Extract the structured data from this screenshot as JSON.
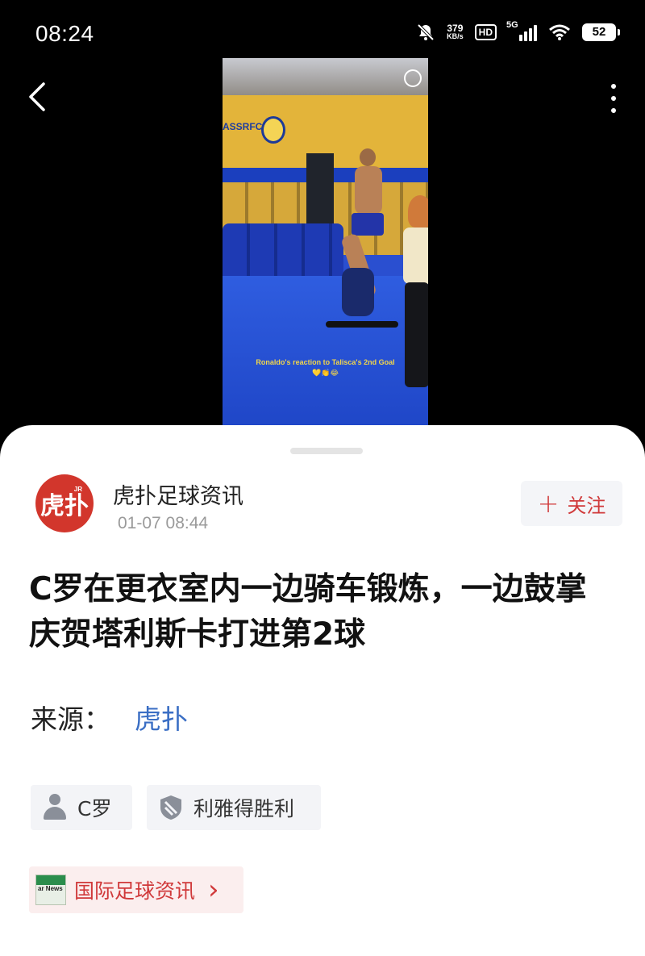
{
  "status_bar": {
    "time": "08:24",
    "net_speed_value": "379",
    "net_speed_unit": "KB/s",
    "hd_label": "HD",
    "network_label": "5G",
    "battery_level": "52",
    "icons": [
      "mute-bell-icon",
      "hd-icon",
      "signal-5g-icon",
      "wifi-icon",
      "battery-icon"
    ]
  },
  "video": {
    "wall_text": "ASSRFC",
    "caption": "Ronaldo's reaction to Talisca's 2nd Goal",
    "caption_emojis": "💛👏😂"
  },
  "nav": {
    "back_icon": "chevron-left-icon",
    "more_icon": "more-vertical-icon"
  },
  "author": {
    "avatar_text": "虎扑",
    "avatar_badge": "JR",
    "name": "虎扑足球资讯",
    "time": "01-07 08:44",
    "follow_label": "关注",
    "follow_icon": "+"
  },
  "article": {
    "title": "C罗在更衣室内一边骑车锻炼，一边鼓掌庆贺塔利斯卡打进第2球",
    "source_label": "来源：",
    "source_name": "虎扑"
  },
  "tags": [
    {
      "label": "C罗",
      "icon": "person-icon"
    },
    {
      "label": "利雅得胜利",
      "icon": "shield-icon"
    }
  ],
  "topic": {
    "label": "国际足球资讯",
    "thumb_text": "ar News",
    "chevron": "›"
  },
  "colors": {
    "accent_red": "#d0393a",
    "link_blue": "#3a6ec4",
    "avatar_red": "#d2362c"
  }
}
